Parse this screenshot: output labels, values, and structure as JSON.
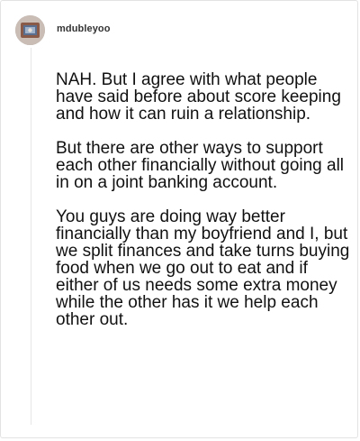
{
  "post": {
    "username": "mdubleyoo",
    "avatar_icon": "user-avatar-icon",
    "paragraphs": [
      "NAH. But I agree with what people have said before about score keeping and how it can ruin a relationship.",
      "But there are other ways to support each other financially without going all in on a joint banking account.",
      "You guys are doing way better financially than my boyfriend and I, but we split finances and take turns buying food when we go out to eat and if either of us needs some extra money while the other has it we help each other out."
    ]
  },
  "colors": {
    "text": "#111111",
    "username": "#333333",
    "border": "#e3e3e3",
    "thread_line": "#e6e6e6"
  }
}
